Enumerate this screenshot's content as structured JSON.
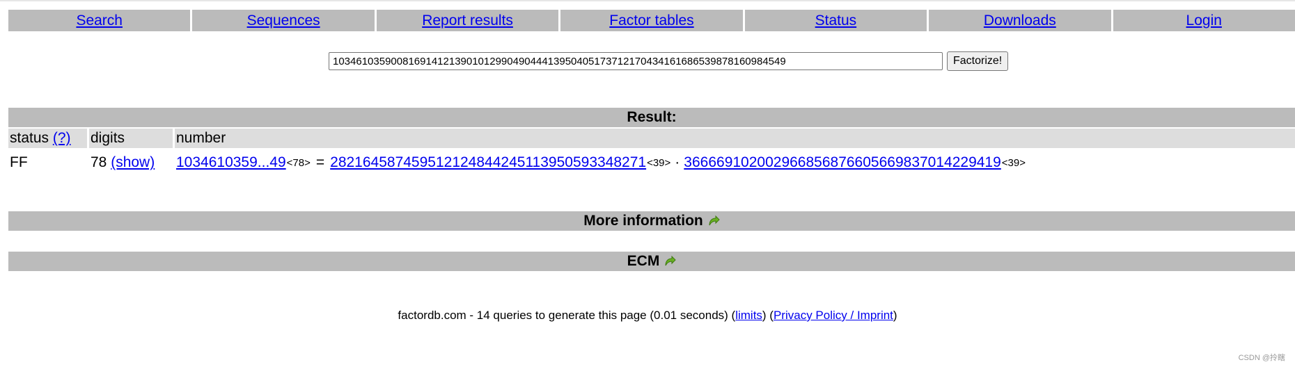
{
  "nav": {
    "items": [
      "Search",
      "Sequences",
      "Report results",
      "Factor tables",
      "Status",
      "Downloads",
      "Login"
    ]
  },
  "search": {
    "value": "1034610359008169141213901012990490444139504051737121704341616865398781609845​49",
    "button_label": "Factorize!"
  },
  "result": {
    "title": "Result:",
    "headers": {
      "status": "status",
      "status_help": "(?)",
      "digits": "digits",
      "number": "number"
    },
    "row": {
      "status": "FF",
      "digits": "78",
      "show_label": "(show)",
      "number_short": "1034610359...49",
      "number_size": "<78>",
      "equals": "=",
      "factor1": "282164587459512124844245113950593348271",
      "factor1_size": "<39>",
      "times": "·",
      "factor2": "366669102002966856876605669837014229419",
      "factor2_size": "<39>"
    }
  },
  "more_info": {
    "title": "More information"
  },
  "ecm": {
    "title": "ECM"
  },
  "footer": {
    "text": "factordb.com - 14 queries to generate this page (0.01 seconds) (",
    "limits_label": "limits",
    "mid": ") (",
    "privacy_label": "Privacy Policy / Imprint",
    "end": ")"
  },
  "watermark": "CSDN @拎瞎",
  "colors": {
    "bar": "#bbbbbb",
    "header": "#dddddd",
    "link": "#0000ee",
    "arrow": "#6ab023"
  },
  "icons": {
    "more_info_arrow": "green-curved-arrow-icon",
    "ecm_arrow": "green-curved-arrow-icon"
  }
}
